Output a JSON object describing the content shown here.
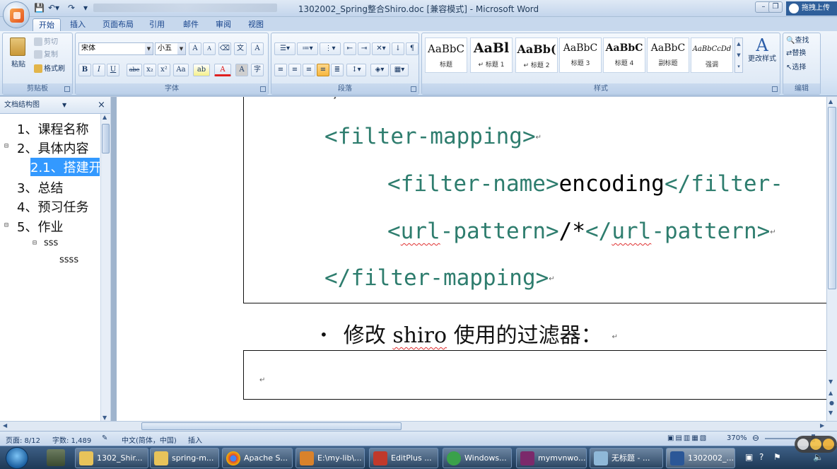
{
  "window": {
    "title": "1302002_Spring整合Shiro.doc [兼容模式] - Microsoft Word",
    "baidu_label": "拖拽上传",
    "controls": {
      "minimize": "–",
      "restore": "❐",
      "close": "✕"
    }
  },
  "ribbon": {
    "tabs": [
      "开始",
      "插入",
      "页面布局",
      "引用",
      "邮件",
      "审阅",
      "视图"
    ],
    "active_tab": "开始",
    "clipboard": {
      "paste": "粘贴",
      "cut": "剪切",
      "copy": "复制",
      "format_painter": "格式刷",
      "group": "剪贴板"
    },
    "font": {
      "name": "宋体",
      "size": "小五",
      "group": "字体",
      "grow": "A",
      "shrink": "A",
      "bold": "B",
      "italic": "I",
      "underline": "U",
      "strike": "abe",
      "sub": "x₂",
      "sup": "x²",
      "change_case": "Aa",
      "highlight": "ab",
      "font_color": "A",
      "char_shade": "A",
      "enclose": "字"
    },
    "paragraph": {
      "group": "段落"
    },
    "styles": {
      "group": "样式",
      "items": [
        {
          "sample": "AaBbC",
          "label": "标题"
        },
        {
          "sample": "AaBl",
          "label": "↵ 标题 1"
        },
        {
          "sample": "AaBb(",
          "label": "↵ 标题 2"
        },
        {
          "sample": "AaBbC",
          "label": "标题 3"
        },
        {
          "sample": "AaBbC",
          "label": "标题 4"
        },
        {
          "sample": "AaBbC",
          "label": "副标题"
        },
        {
          "sample": "AaBbCcDd",
          "label": "强调"
        }
      ],
      "change_styles": "更改样式"
    },
    "editing": {
      "find": "查找",
      "replace": "替换",
      "select": "选择",
      "group": "编辑"
    }
  },
  "nav": {
    "header": "文档结构图",
    "close": "×",
    "items": [
      {
        "text": "1、课程名称"
      },
      {
        "text": "2、具体内容",
        "expander": "⊟"
      },
      {
        "text": "2.1、搭建开",
        "selected": true
      },
      {
        "text": "3、总结"
      },
      {
        "text": "4、预习任务"
      },
      {
        "text": "5、作业",
        "expander": "⊟"
      },
      {
        "text": "sss",
        "expander": "⊟"
      },
      {
        "text": "ssss"
      }
    ]
  },
  "document": {
    "prev_line": "/",
    "code": {
      "open_tag": "<filter-mapping>",
      "name_open": "<filter-name>",
      "name_value": "encoding",
      "name_close": "</filter-",
      "url_open_lt": "<",
      "url_open_word": "url",
      "url_open_rest": "-pattern>",
      "url_value": "/*",
      "url_close_lt": "</",
      "url_close_word": "url",
      "url_close_rest": "-pattern>",
      "close_tag": "</filter-mapping>"
    },
    "bullet": "•",
    "bullet_text_before": "修改 ",
    "bullet_text_shiro": "shiro",
    "bullet_text_after": " 使用的过滤器：",
    "para_mark": "↵"
  },
  "status": {
    "page": "页面: 8/12",
    "words": "字数: 1,489",
    "language": "中文(简体，中国)",
    "insert_mode": "插入",
    "zoom": "370%"
  },
  "taskbar": {
    "items": [
      {
        "label": "1302_Shir...",
        "icon_color": "#e8c35a"
      },
      {
        "label": "spring-m...",
        "icon_color": "#e8c35a"
      },
      {
        "label": "Apache S...",
        "icon_color": "#db4437"
      },
      {
        "label": "E:\\my-lib\\...",
        "icon_color": "#d9822b"
      },
      {
        "label": "EditPlus ...",
        "icon_color": "#c0392b"
      },
      {
        "label": "Windows...",
        "icon_color": "#3aa14a"
      },
      {
        "label": "mymvnwo...",
        "icon_color": "#7b2a6b"
      },
      {
        "label": "无标题 - ...",
        "icon_color": "#8fb8d8"
      },
      {
        "label": "1302002_...",
        "icon_color": "#2b5797"
      }
    ]
  }
}
